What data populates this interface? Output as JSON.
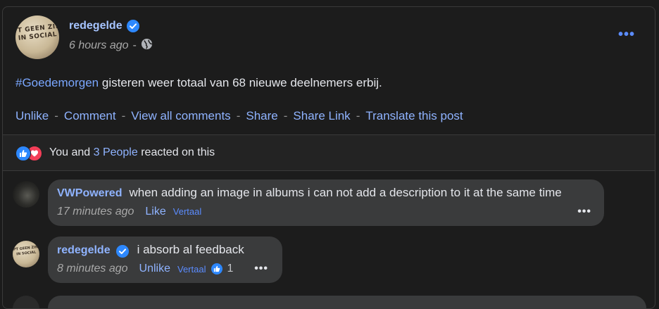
{
  "post": {
    "author": "redegelde",
    "avatar_sign_text": "PT GEEN ZIN\nIN SOCIAL",
    "time": "6 hours ago",
    "separator": "-",
    "hashtag": "#Goedemorgen",
    "body": "gisteren weer totaal van 68 nieuwe deelnemers erbij.",
    "more_icon": "ellipsis-icon"
  },
  "actions": [
    {
      "label": "Unlike"
    },
    {
      "label": "Comment"
    },
    {
      "label": "View all comments"
    },
    {
      "label": "Share"
    },
    {
      "label": "Share Link"
    },
    {
      "label": "Translate this post"
    }
  ],
  "actions_separator": "-",
  "reactions": {
    "prefix": "You and",
    "count_label": "3 People",
    "suffix": "reacted on this",
    "icons": [
      "like-icon",
      "love-icon"
    ]
  },
  "comments": [
    {
      "author": "VWPowered",
      "text": "when adding an image in albums i can not add a description to it at the same time",
      "time": "17 minutes ago",
      "like_label": "Like",
      "translate_label": "Vertaal",
      "verified": false,
      "like_count": ""
    },
    {
      "author": "redegelde",
      "text": "i absorb al feedback",
      "time": "8 minutes ago",
      "like_label": "Unlike",
      "translate_label": "Vertaal",
      "verified": true,
      "like_count": "1"
    }
  ],
  "colors": {
    "background": "#1c1c1c",
    "link": "#8fb3ff",
    "bubble": "#3a3b3c",
    "verified": "#2d88ff",
    "love": "#f33e58"
  }
}
